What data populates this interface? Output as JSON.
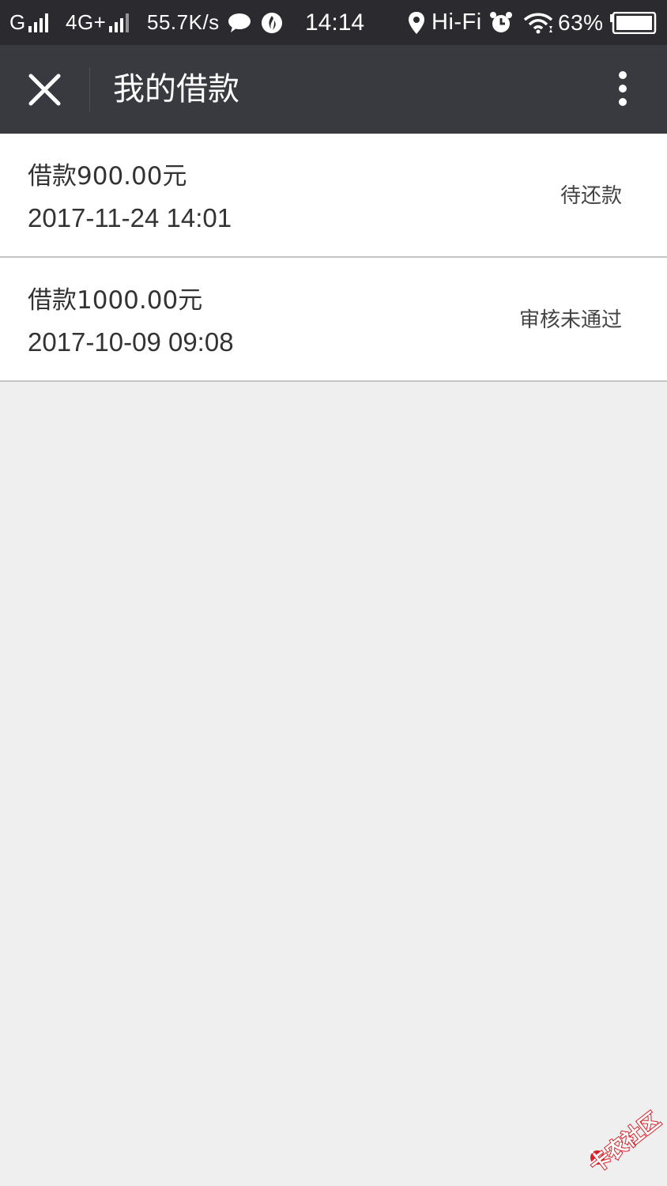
{
  "status_bar": {
    "carrier1": "G",
    "carrier2": "4G+",
    "net_speed": "55.7K/s",
    "time": "14:14",
    "wifi_label": "Hi-Fi",
    "battery": "63%"
  },
  "nav": {
    "title": "我的借款"
  },
  "loans": [
    {
      "amount": "借款900.00元",
      "date": "2017-11-24 14:01",
      "status": "待还款"
    },
    {
      "amount": "借款1000.00元",
      "date": "2017-10-09 09:08",
      "status": "审核未通过"
    }
  ],
  "watermark": {
    "text": "卡农社区",
    "color": "#d7222a"
  },
  "colors": {
    "status_bar_bg": "#2b2b2f",
    "nav_bg": "#393a3f",
    "page_bg": "#efefef",
    "row_bg": "#ffffff"
  }
}
